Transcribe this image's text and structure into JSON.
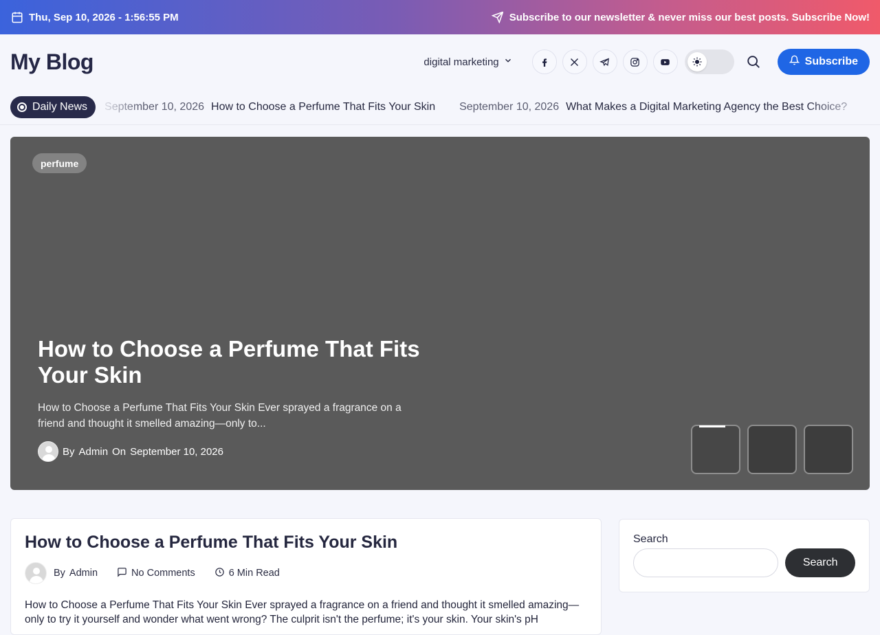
{
  "topbar": {
    "datetime": "Thu, Sep 10, 2026 - 1:56:55 PM",
    "newsletter_text": "Subscribe to our newsletter & never miss our best posts. Subscribe Now!"
  },
  "header": {
    "logo": "My Blog",
    "menu_item": "digital marketing",
    "socials": [
      "facebook-icon",
      "x-icon",
      "telegram-icon",
      "instagram-icon",
      "youtube-icon"
    ],
    "subscribe_label": "Subscribe"
  },
  "ticker": {
    "badge": "Daily News",
    "items": [
      {
        "date": "September 10, 2026",
        "title": "How to Choose a Perfume That Fits Your Skin"
      },
      {
        "date": "September 10, 2026",
        "title": "What Makes a Digital Marketing Agency the Best Choice?"
      }
    ]
  },
  "hero": {
    "tag": "perfume",
    "title": "How to Choose a Perfume That Fits Your Skin",
    "excerpt": "How to Choose a Perfume That Fits Your Skin Ever sprayed a fragrance on a friend and thought it smelled amazing—only to...",
    "by_label": "By",
    "author": "Admin",
    "on_label": "On",
    "date": "September 10, 2026"
  },
  "post": {
    "title": "How to Choose a Perfume That Fits Your Skin",
    "by_label": "By",
    "author": "Admin",
    "comments": "No Comments",
    "read_time": "6 Min Read",
    "text": "How to Choose a Perfume That Fits Your Skin Ever sprayed a fragrance on a friend and thought it smelled amazing—only to try it yourself and wonder what went wrong? The culprit isn't the perfume; it's your skin. Your skin's pH"
  },
  "sidebar": {
    "search_label": "Search",
    "search_button": "Search",
    "search_value": ""
  },
  "colors": {
    "accent": "#1f66e5",
    "dark": "#282a4a",
    "hero_bg": "#5a5a5a"
  }
}
